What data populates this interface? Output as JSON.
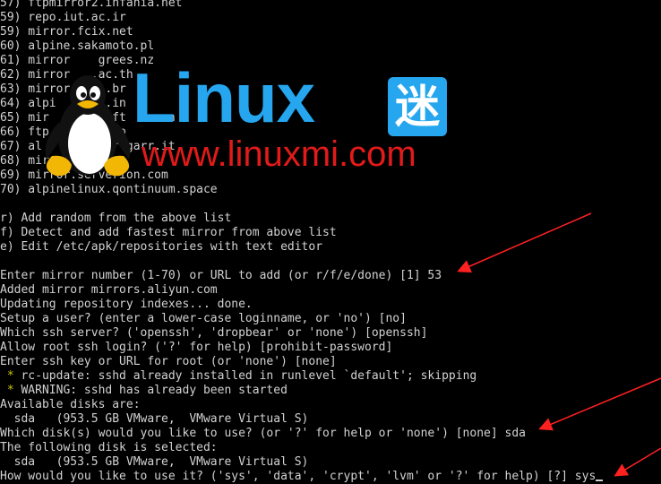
{
  "terminal": {
    "lines": [
      "57) ftpmirror2.infania.net",
      "59) repo.iut.ac.ir",
      "59) mirror.fcix.net",
      "60) alpine.sakamoto.pl",
      "61) mirror    grees.nz",
      "62) mirror   .ac.th",
      "63) mirror     .br",
      "64) alpi       .in",
      "65) mir        oft     cn",
      "66) ftp       e.jp",
      "67) al        ror.garr.it",
      "68) mir       om",
      "69) mirror.serverion.com",
      "70) alpinelinux.qontinuum.space",
      "",
      "r) Add random from the above list",
      "f) Detect and add fastest mirror from above list",
      "e) Edit /etc/apk/repositories with text editor",
      "",
      "Enter mirror number (1-70) or URL to add (or r/f/e/done) [1] 53",
      "Added mirror mirrors.aliyun.com",
      "Updating repository indexes... done.",
      "Setup a user? (enter a lower-case loginname, or 'no') [no]",
      "Which ssh server? ('openssh', 'dropbear' or 'none') [openssh]",
      "Allow root ssh login? ('?' for help) [prohibit-password]",
      "Enter ssh key or URL for root (or 'none') [none]",
      " * rc-update: sshd already installed in runlevel `default'; skipping",
      " * WARNING: sshd has already been started",
      "Available disks are:",
      "  sda   (953.5 GB VMware,  VMware Virtual S)",
      "Which disk(s) would you like to use? (or '?' for help or 'none') [none] sda",
      "The following disk is selected:",
      "  sda   (953.5 GB VMware,  VMware Virtual S)",
      "How would you like to use it? ('sys', 'data', 'crypt', 'lvm' or '?' for help) [?] sys"
    ],
    "star_lines": [
      26,
      27
    ],
    "cursor_line": 33
  },
  "watermark": {
    "word": "Linux",
    "cjk": "迷",
    "url": "www.linuxmi.com"
  },
  "colors": {
    "background": "#000000",
    "text": "#d2d2d2",
    "star": "#c6c600",
    "logo_blue": "#25a6ee",
    "logo_red": "#e21a1a",
    "arrow_red": "#ff2020"
  }
}
